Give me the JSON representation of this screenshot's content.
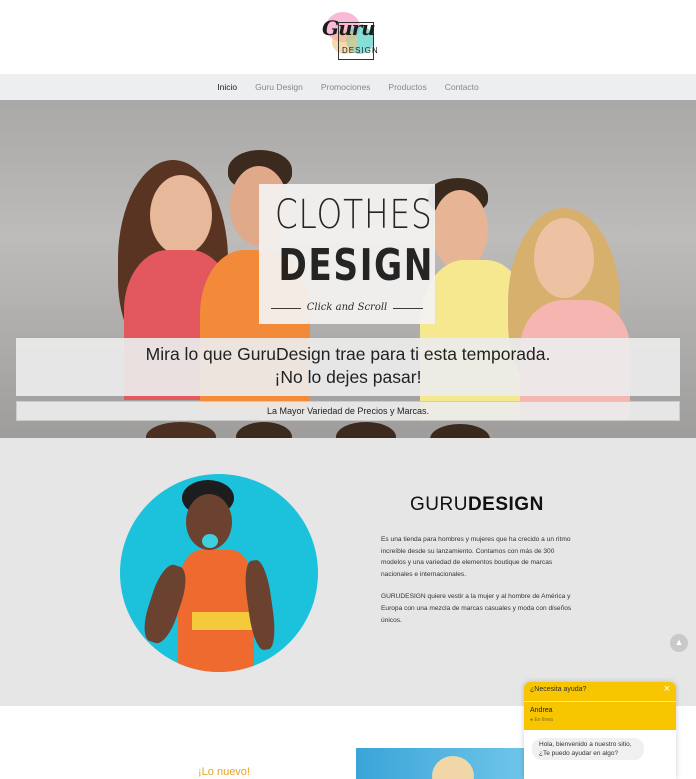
{
  "logo": {
    "script_text": "Guru",
    "small_text": "DESIGN"
  },
  "nav": {
    "items": [
      {
        "label": "Inicio",
        "active": true
      },
      {
        "label": "Guru Design",
        "active": false
      },
      {
        "label": "Promociones",
        "active": false
      },
      {
        "label": "Productos",
        "active": false
      },
      {
        "label": "Contacto",
        "active": false
      }
    ]
  },
  "hero": {
    "line1": "CLOTHES",
    "line2": "DESIGN",
    "tagline": "Click and Scroll",
    "banner_line1": "Mira lo que GuruDesign trae para ti esta temporada.",
    "banner_line2": "¡No lo dejes pasar!",
    "sub_banner": "La Mayor Variedad de Precios y Marcas."
  },
  "about": {
    "title_light": "GURU",
    "title_bold": "DESIGN",
    "paragraph1": "Es una tienda para hombres y mujeres que ha crecido a un ritmo increíble desde su lanzamiento. Contamos con más de 300 modelos y una variedad de elementos boutique de marcas nacionales e internacionales.",
    "paragraph2": "GURUDESIGN quiere vestir a la mujer y al hombre de América y Europa con una mezcla de marcas casuales y moda con diseños únicos."
  },
  "bottom": {
    "new_label": "¡Lo nuevo!"
  },
  "chat": {
    "question": "¿Necesita ayuda?",
    "close_glyph": "×",
    "agent_name": "Andrea",
    "agent_status": "● En línea",
    "message": "Hola, bienvenido a nuestro sitio, ¿Te puedo ayudar en algo?"
  },
  "scroll_top_glyph": "▲",
  "colors": {
    "accent_yellow": "#f7c600",
    "new_label_orange": "#e8a423",
    "circle_cyan": "#1cc2dc"
  }
}
